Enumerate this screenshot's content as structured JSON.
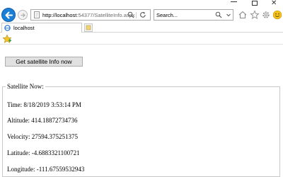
{
  "browser": {
    "address_host": "http://localhost",
    "address_port": ":54377",
    "address_path": "/SatelliteInfo.aspx",
    "search_placeholder": "Search...",
    "tab_title": "localhost",
    "window_controls": [
      "minimize",
      "maximize",
      "close"
    ],
    "icons": [
      "back-icon",
      "forward-icon",
      "page-icon",
      "search-icon",
      "refresh-icon",
      "home-icon",
      "favorites-star-icon",
      "settings-gear-icon",
      "smiley-icon",
      "new-tab-icon",
      "add-favorite-star-icon"
    ],
    "accent_color": "#1b7fd6"
  },
  "page": {
    "button_label": "Get satellite Info now",
    "fieldset_legend": "Satellite Now:",
    "lines": [
      "Time: 8/18/2019 3:53:14 PM",
      "Altitude: 414.18872734736",
      "Velocity: 27594.375251375",
      "Latitude: -4.6883321100721",
      "Longitude: -111.67559532943"
    ]
  }
}
